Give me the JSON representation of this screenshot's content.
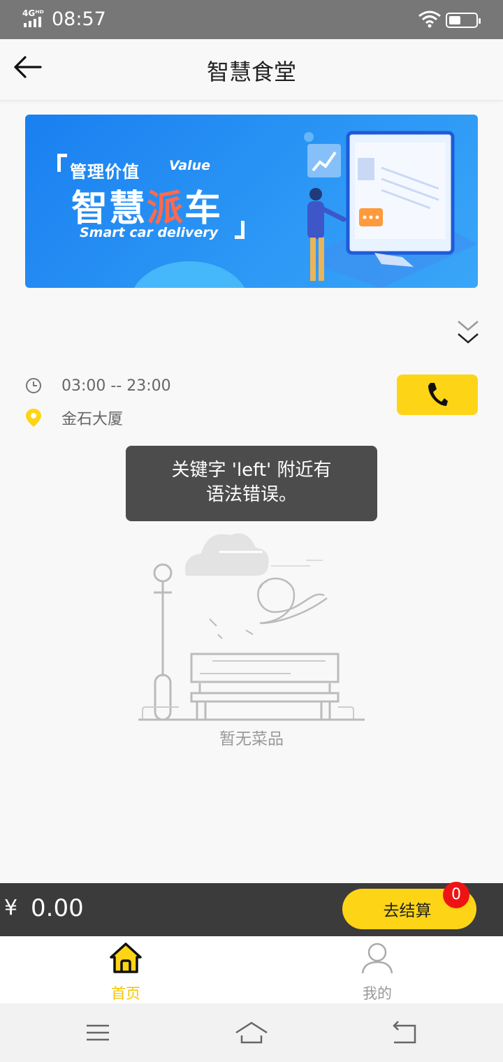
{
  "status_bar": {
    "network": "4Gᴴᴰ",
    "time": "08:57"
  },
  "nav": {
    "title": "智慧食堂"
  },
  "banner": {
    "kicker": "管理价值",
    "kicker_en": "Value",
    "headline_part1": "智慧",
    "headline_highlight": "派",
    "headline_part2": "车",
    "subtitle_en": "Smart car delivery",
    "accent_color": "#ff6a4d"
  },
  "store": {
    "hours": "03:00 -- 23:00",
    "address": "金石大厦"
  },
  "toast": {
    "line1": "关键字 'left' 附近有",
    "line2": "语法错误。"
  },
  "empty_state": {
    "text": "暂无菜品"
  },
  "checkout": {
    "currency": "¥",
    "amount": "0.00",
    "button_label": "去结算",
    "badge_count": "0"
  },
  "tabs": [
    {
      "label": "首页",
      "icon": "home-icon",
      "active": true
    },
    {
      "label": "我的",
      "icon": "user-icon",
      "active": false
    }
  ],
  "colors": {
    "accent": "#fdd516",
    "badge": "#ef1414",
    "toolbar_dark": "#3b3b3b"
  }
}
